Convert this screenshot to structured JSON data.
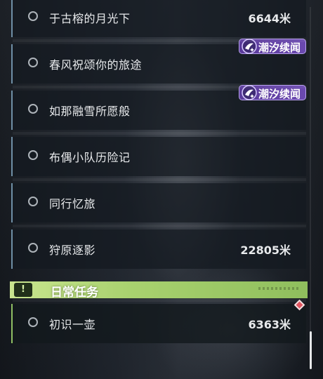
{
  "quests": [
    {
      "name": "于古榕的月光下",
      "distance": "6644米",
      "badge": ""
    },
    {
      "name": "春风祝颂你的旅途",
      "distance": "",
      "badge": "潮汐续闻"
    },
    {
      "name": "如那融雪所愿般",
      "distance": "",
      "badge": "潮汐续闻"
    },
    {
      "name": "布偶小队历险记",
      "distance": "",
      "badge": ""
    },
    {
      "name": "同行忆旅",
      "distance": "",
      "badge": ""
    },
    {
      "name": "狩原逐影",
      "distance": "22805米",
      "badge": ""
    }
  ],
  "daily_section": {
    "title": "日常任务",
    "icon": "alert-icon",
    "icon_glyph": "!",
    "quests": [
      {
        "name": "初识一壶",
        "distance": "6363米"
      }
    ]
  },
  "colors": {
    "quest_accent": "#6f8fa6",
    "daily_accent": "#8fbf64",
    "badge_purple": "#6b49b0",
    "marker_red": "#e0545f"
  }
}
